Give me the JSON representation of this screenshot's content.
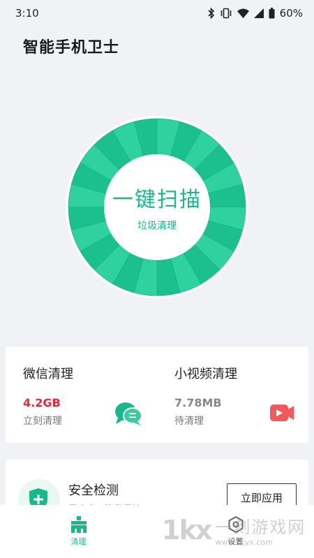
{
  "status_bar": {
    "time": "3:10",
    "battery": "60%",
    "icons": [
      "bluetooth-icon",
      "vibrate-icon",
      "wifi-icon",
      "signal-icon",
      "battery-icon"
    ]
  },
  "app": {
    "title": "智能手机卫士"
  },
  "scan": {
    "main_label": "一键扫描",
    "sub_label": "垃圾清理"
  },
  "clean": {
    "wechat": {
      "title": "微信清理",
      "size": "4.2GB",
      "status": "立刻清理",
      "icon": "chat-bubbles-icon"
    },
    "video": {
      "title": "小视频清理",
      "size": "7.78MB",
      "status": "待清理",
      "icon": "video-icon"
    }
  },
  "security": {
    "title": "安全检测",
    "desc": "无病毒，隐私保护",
    "button": "立即应用",
    "icon": "shield-plus-icon"
  },
  "nav": {
    "items": [
      {
        "label": "清理",
        "icon": "broom-icon",
        "active": true
      },
      {
        "label": "设置",
        "icon": "settings-icon",
        "active": false
      }
    ]
  },
  "watermark": {
    "logo": "1kx",
    "name": "一刻游戏网",
    "url": "www.1kyx.com"
  },
  "colors": {
    "accent": "#17B98A",
    "red": "#E8273A",
    "gray_size": "#888888",
    "video_icon": "#F05A5A",
    "background": "#F1F2F6"
  }
}
